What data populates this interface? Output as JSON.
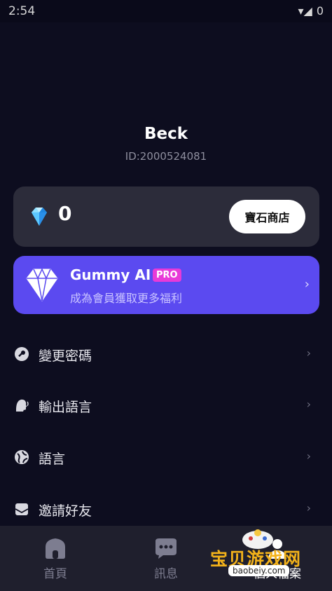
{
  "status_bar": {
    "time": "2:54",
    "signal_icons": "▾◢",
    "battery": "0"
  },
  "profile": {
    "name": "Beck",
    "id": "ID:2000524081"
  },
  "wallet": {
    "gem_count": "0",
    "shop_button": "寶石商店",
    "icon": "diamond-icon"
  },
  "pro_banner": {
    "title": "Gummy AI",
    "badge": "PRO",
    "subtitle": "成為會員獲取更多福利",
    "chevron": "›"
  },
  "menu": {
    "items": [
      {
        "label": "變更密碼",
        "icon": "key-icon"
      },
      {
        "label": "輸出語言",
        "icon": "speaking-head-icon"
      },
      {
        "label": "語言",
        "icon": "globe-icon"
      },
      {
        "label": "邀請好友",
        "icon": "mail-icon"
      }
    ],
    "chevron": "›"
  },
  "tab_bar": {
    "tabs": [
      {
        "label": "首頁",
        "icon": "home-icon"
      },
      {
        "label": "訊息",
        "icon": "chat-icon"
      },
      {
        "label": "個人檔案",
        "icon": "profile-icon"
      }
    ]
  },
  "watermark": {
    "text": "宝贝游戏网",
    "url": "baobeiy.com"
  },
  "colors": {
    "background": "#0d0d1f",
    "card": "#2c2c3a",
    "pro_banner": "#5b4af0",
    "pro_badge": "#e83ad8",
    "tab_bar": "#1f1f2d"
  }
}
